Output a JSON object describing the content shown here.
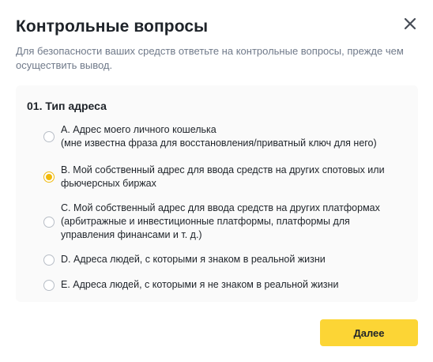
{
  "dialog": {
    "title": "Контрольные вопросы",
    "subtitle": "Для безопасности ваших средств ответьте на контрольные вопросы, прежде чем осуществить вывод.",
    "close_icon": "close-icon"
  },
  "question": {
    "label": "01. Тип адреса",
    "selected_option": "B",
    "options": [
      {
        "label": "A. Адрес моего личного кошелька\n(мне известна фраза для восстановления/приватный ключ для него)",
        "checked": false
      },
      {
        "label": "B. Мой собственный адрес для ввода средств на других спотовых или фьючерсных биржах",
        "checked": true
      },
      {
        "label": "C. Мой собственный адрес для ввода средств на других платформах (арбитражные и инвестиционные платформы, платформы для управления финансами и т. д.)",
        "checked": false
      },
      {
        "label": "D. Адреса людей, с которыми я знаком в реальной жизни",
        "checked": false
      },
      {
        "label": "E. Адреса людей, с которыми я не знаком в реальной жизни",
        "checked": false
      }
    ]
  },
  "footer": {
    "next_label": "Далее"
  },
  "colors": {
    "accent": "#f0b90b",
    "button": "#fcd535",
    "card_bg": "#fafafa",
    "muted_text": "#707a8a"
  }
}
